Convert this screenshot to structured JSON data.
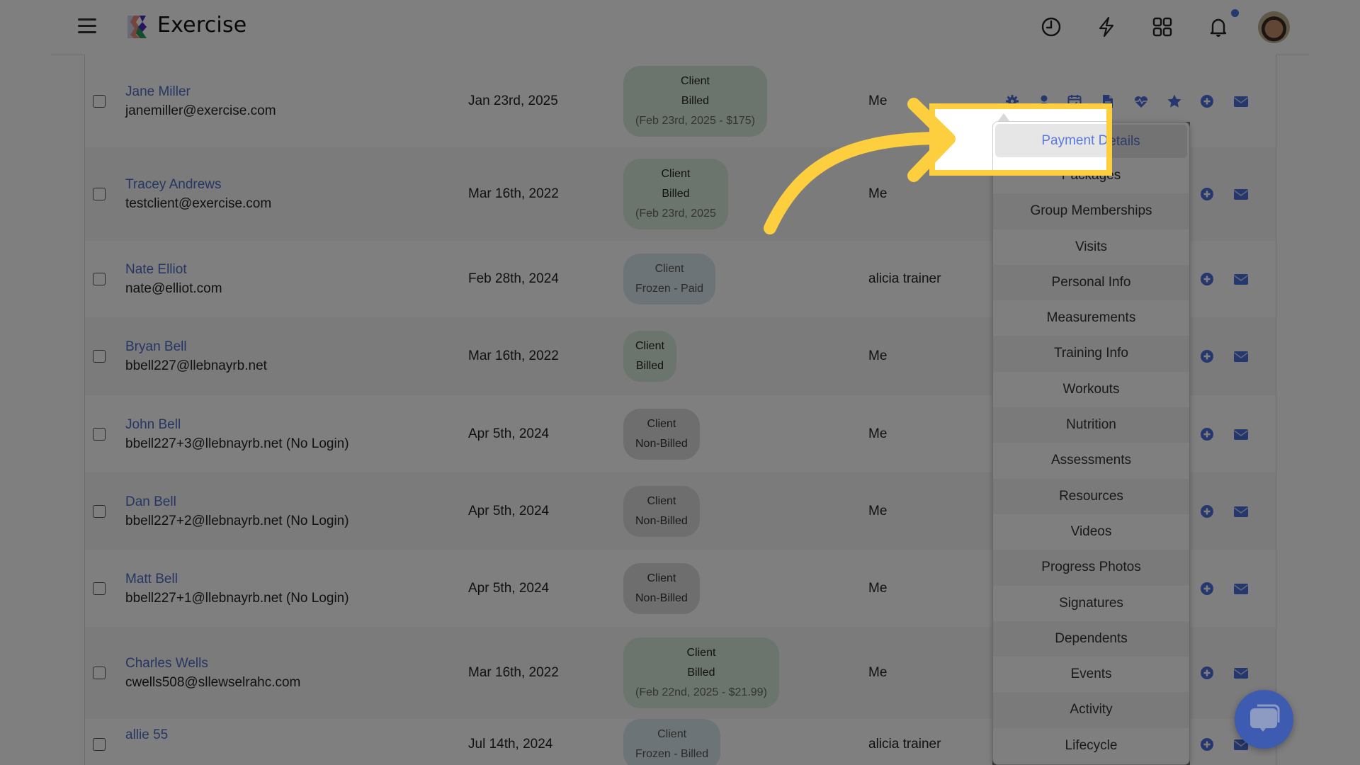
{
  "app": {
    "brand": "Exercise",
    "icons": [
      "menu-icon",
      "history-clock-icon",
      "lightning-icon",
      "apps-grid-icon",
      "bell-icon",
      "user-avatar"
    ],
    "has_notification": true
  },
  "colors": {
    "accent": "#4a6fd8",
    "link": "#4d6bc6",
    "highlight": "#fdcf3f",
    "badge_billed": "#d9ebdb",
    "badge_frozen": "#dbe9ee",
    "badge_nonbilled": "#dcdcdc"
  },
  "clients": [
    {
      "name": "Jane Miller",
      "email": "janemiller@exercise.com",
      "date": "Jan 23rd, 2025",
      "badge": {
        "type": "billed",
        "line1": "Client",
        "line2": "Billed",
        "line3": "(Feb 23rd, 2025 - $175)"
      },
      "trainer": "Me"
    },
    {
      "name": "Tracey Andrews",
      "email": "testclient@exercise.com",
      "date": "Mar 16th, 2022",
      "badge": {
        "type": "billed",
        "line1": "Client",
        "line2": "Billed",
        "line3": "(Feb 23rd, 2025"
      },
      "trainer": "Me"
    },
    {
      "name": "Nate Elliot",
      "email": "nate@elliot.com",
      "date": "Feb 28th, 2024",
      "badge": {
        "type": "frozen",
        "line1": "Client",
        "line2": "Frozen - Paid",
        "line3": ""
      },
      "trainer": "alicia trainer"
    },
    {
      "name": "Bryan Bell",
      "email": "bbell227@llebnayrb.net",
      "date": "Mar 16th, 2022",
      "badge": {
        "type": "billed",
        "line1": "Client",
        "line2": "Billed",
        "line3": ""
      },
      "trainer": "Me"
    },
    {
      "name": "John Bell",
      "email": "bbell227+3@llebnayrb.net (No Login)",
      "date": "Apr 5th, 2024",
      "badge": {
        "type": "nonbilled",
        "line1": "Client",
        "line2": "Non-Billed",
        "line3": ""
      },
      "trainer": "Me"
    },
    {
      "name": "Dan Bell",
      "email": "bbell227+2@llebnayrb.net (No Login)",
      "date": "Apr 5th, 2024",
      "badge": {
        "type": "nonbilled",
        "line1": "Client",
        "line2": "Non-Billed",
        "line3": ""
      },
      "trainer": "Me"
    },
    {
      "name": "Matt Bell",
      "email": "bbell227+1@llebnayrb.net (No Login)",
      "date": "Apr 5th, 2024",
      "badge": {
        "type": "nonbilled",
        "line1": "Client",
        "line2": "Non-Billed",
        "line3": ""
      },
      "trainer": "Me"
    },
    {
      "name": "Charles Wells",
      "email": "cwells508@sllewselrahc.com",
      "date": "Mar 16th, 2022",
      "badge": {
        "type": "billed",
        "line1": "Client",
        "line2": "Billed",
        "line3": "(Feb 22nd, 2025 - $21.99)"
      },
      "trainer": "Me"
    },
    {
      "name": "allie 55",
      "email": "",
      "date": "Jul 14th, 2024",
      "badge": {
        "type": "frozen",
        "line1": "Client",
        "line2": "Frozen - Billed",
        "line3": ""
      },
      "trainer": "alicia trainer"
    }
  ],
  "row_actions_expanded": [
    "settings-gear-icon",
    "user-icon",
    "calendar-icon",
    "document-icon",
    "heartbeat-icon",
    "star-icon",
    "add-circle-icon",
    "envelope-icon"
  ],
  "row_actions": [
    "add-circle-icon",
    "envelope-icon"
  ],
  "dropdown": {
    "active": "Payment Details",
    "items": [
      "Payment Details",
      "Packages",
      "Group Memberships",
      "Visits",
      "Personal Info",
      "Measurements",
      "Training Info",
      "Workouts",
      "Nutrition",
      "Assessments",
      "Resources",
      "Videos",
      "Progress Photos",
      "Signatures",
      "Dependents",
      "Events",
      "Activity",
      "Lifecycle"
    ]
  },
  "chat": {
    "icon": "chat-bubble-icon"
  }
}
